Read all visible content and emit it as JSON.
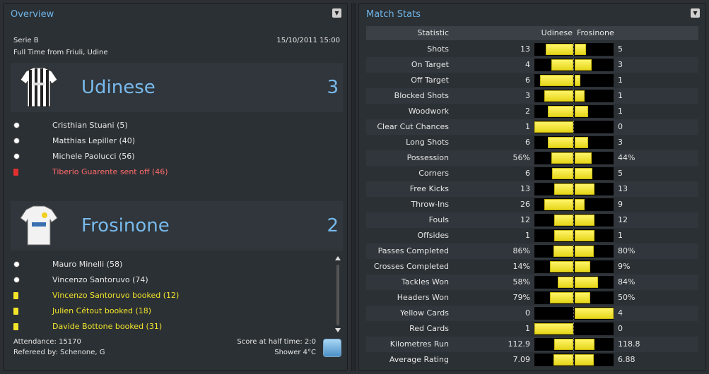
{
  "overview": {
    "title": "Overview",
    "competition": "Serie B",
    "datetime": "15/10/2011 15:00",
    "venue_line": "Full Time from Friuli, Udine",
    "home": {
      "name": "Udinese",
      "score": "3",
      "events": [
        {
          "type": "goal",
          "text": "Cristhian Stuani (5)"
        },
        {
          "type": "goal",
          "text": "Matthias Lepiller (40)"
        },
        {
          "type": "goal",
          "text": "Michele Paolucci (56)"
        },
        {
          "type": "red",
          "text": "Tiberio Guarente sent off (46)"
        }
      ]
    },
    "away": {
      "name": "Frosinone",
      "score": "2",
      "events": [
        {
          "type": "goal",
          "text": "Mauro Minelli (58)"
        },
        {
          "type": "goal",
          "text": "Vincenzo Santoruvo (74)"
        },
        {
          "type": "yellow",
          "text": "Vincenzo Santoruvo booked (12)"
        },
        {
          "type": "yellow",
          "text": "Julien Cétout booked (18)"
        },
        {
          "type": "yellow",
          "text": "Davide Bottone booked (31)"
        }
      ]
    },
    "attendance": "Attendance: 15170",
    "referee": "Refereed by: Schenone, G",
    "halftime": "Score at half time: 2:0",
    "weather": "Shower 4°C"
  },
  "stats": {
    "title": "Match Stats",
    "col_statistic": "Statistic",
    "col_home": "Udinese",
    "col_away": "Frosinone",
    "rows": [
      {
        "label": "Shots",
        "home": "13",
        "away": "5",
        "h": 13,
        "a": 5
      },
      {
        "label": "On Target",
        "home": "4",
        "away": "3",
        "h": 4,
        "a": 3
      },
      {
        "label": "Off Target",
        "home": "6",
        "away": "1",
        "h": 6,
        "a": 1
      },
      {
        "label": "Blocked Shots",
        "home": "3",
        "away": "1",
        "h": 3,
        "a": 1
      },
      {
        "label": "Woodwork",
        "home": "2",
        "away": "1",
        "h": 2,
        "a": 1
      },
      {
        "label": "Clear Cut Chances",
        "home": "1",
        "away": "0",
        "h": 1,
        "a": 0
      },
      {
        "label": "Long Shots",
        "home": "6",
        "away": "3",
        "h": 6,
        "a": 3
      },
      {
        "label": "Possession",
        "home": "56%",
        "away": "44%",
        "h": 56,
        "a": 44
      },
      {
        "label": "Corners",
        "home": "6",
        "away": "5",
        "h": 6,
        "a": 5
      },
      {
        "label": "Free Kicks",
        "home": "13",
        "away": "13",
        "h": 13,
        "a": 13
      },
      {
        "label": "Throw-Ins",
        "home": "26",
        "away": "9",
        "h": 26,
        "a": 9
      },
      {
        "label": "Fouls",
        "home": "12",
        "away": "12",
        "h": 12,
        "a": 12
      },
      {
        "label": "Offsides",
        "home": "1",
        "away": "1",
        "h": 1,
        "a": 1
      },
      {
        "label": "Passes Completed",
        "home": "86%",
        "away": "80%",
        "h": 86,
        "a": 80
      },
      {
        "label": "Crosses Completed",
        "home": "14%",
        "away": "9%",
        "h": 14,
        "a": 9
      },
      {
        "label": "Tackles Won",
        "home": "58%",
        "away": "84%",
        "h": 58,
        "a": 84
      },
      {
        "label": "Headers Won",
        "home": "79%",
        "away": "50%",
        "h": 79,
        "a": 50
      },
      {
        "label": "Yellow Cards",
        "home": "0",
        "away": "4",
        "h": 0,
        "a": 4
      },
      {
        "label": "Red Cards",
        "home": "1",
        "away": "0",
        "h": 1,
        "a": 0
      },
      {
        "label": "Kilometres Run",
        "home": "112.9",
        "away": "118.8",
        "h": 112.9,
        "a": 118.8
      },
      {
        "label": "Average Rating",
        "home": "7.09",
        "away": "6.88",
        "h": 7.09,
        "a": 6.88
      }
    ]
  }
}
